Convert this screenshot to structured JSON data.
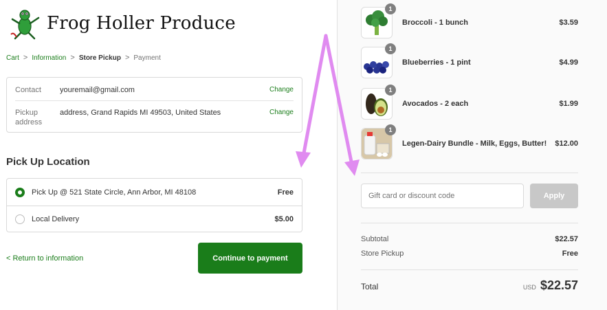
{
  "brand": {
    "name": "Frog Holler Produce"
  },
  "breadcrumb": {
    "cart": "Cart",
    "information": "Information",
    "store_pickup": "Store Pickup",
    "payment": "Payment",
    "separator": ">"
  },
  "review": {
    "contact_label": "Contact",
    "contact_value": "youremail@gmail.com",
    "contact_change": "Change",
    "pickup_label": "Pickup address",
    "pickup_value": "address, Grand Rapids MI 49503, United States",
    "pickup_change": "Change"
  },
  "pickup": {
    "title": "Pick Up Location",
    "options": [
      {
        "label": "Pick Up @ 521 State Circle, Ann Arbor, MI 48108",
        "price": "Free",
        "selected": true
      },
      {
        "label": "Local Delivery",
        "price": "$5.00",
        "selected": false
      }
    ]
  },
  "actions": {
    "return_link": "< Return to information",
    "continue": "Continue to payment"
  },
  "cart": {
    "items": [
      {
        "name": "Broccoli - 1 bunch",
        "price": "$3.59",
        "qty": "1",
        "icon": "broccoli-icon"
      },
      {
        "name": "Blueberries - 1 pint",
        "price": "$4.99",
        "qty": "1",
        "icon": "blueberries-icon"
      },
      {
        "name": "Avocados - 2 each",
        "price": "$1.99",
        "qty": "1",
        "icon": "avocado-icon"
      },
      {
        "name": "Legen-Dairy Bundle - Milk, Eggs, Butter!",
        "price": "$12.00",
        "qty": "1",
        "icon": "dairy-bundle-icon"
      }
    ]
  },
  "discount": {
    "placeholder": "Gift card or discount code",
    "apply": "Apply"
  },
  "summary": {
    "subtotal_label": "Subtotal",
    "subtotal_value": "$22.57",
    "shipping_label": "Store Pickup",
    "shipping_value": "Free",
    "total_label": "Total",
    "currency": "USD",
    "total_value": "$22.57"
  },
  "colors": {
    "accent": "#1a7d1a",
    "annotation": "#e08bf0"
  }
}
